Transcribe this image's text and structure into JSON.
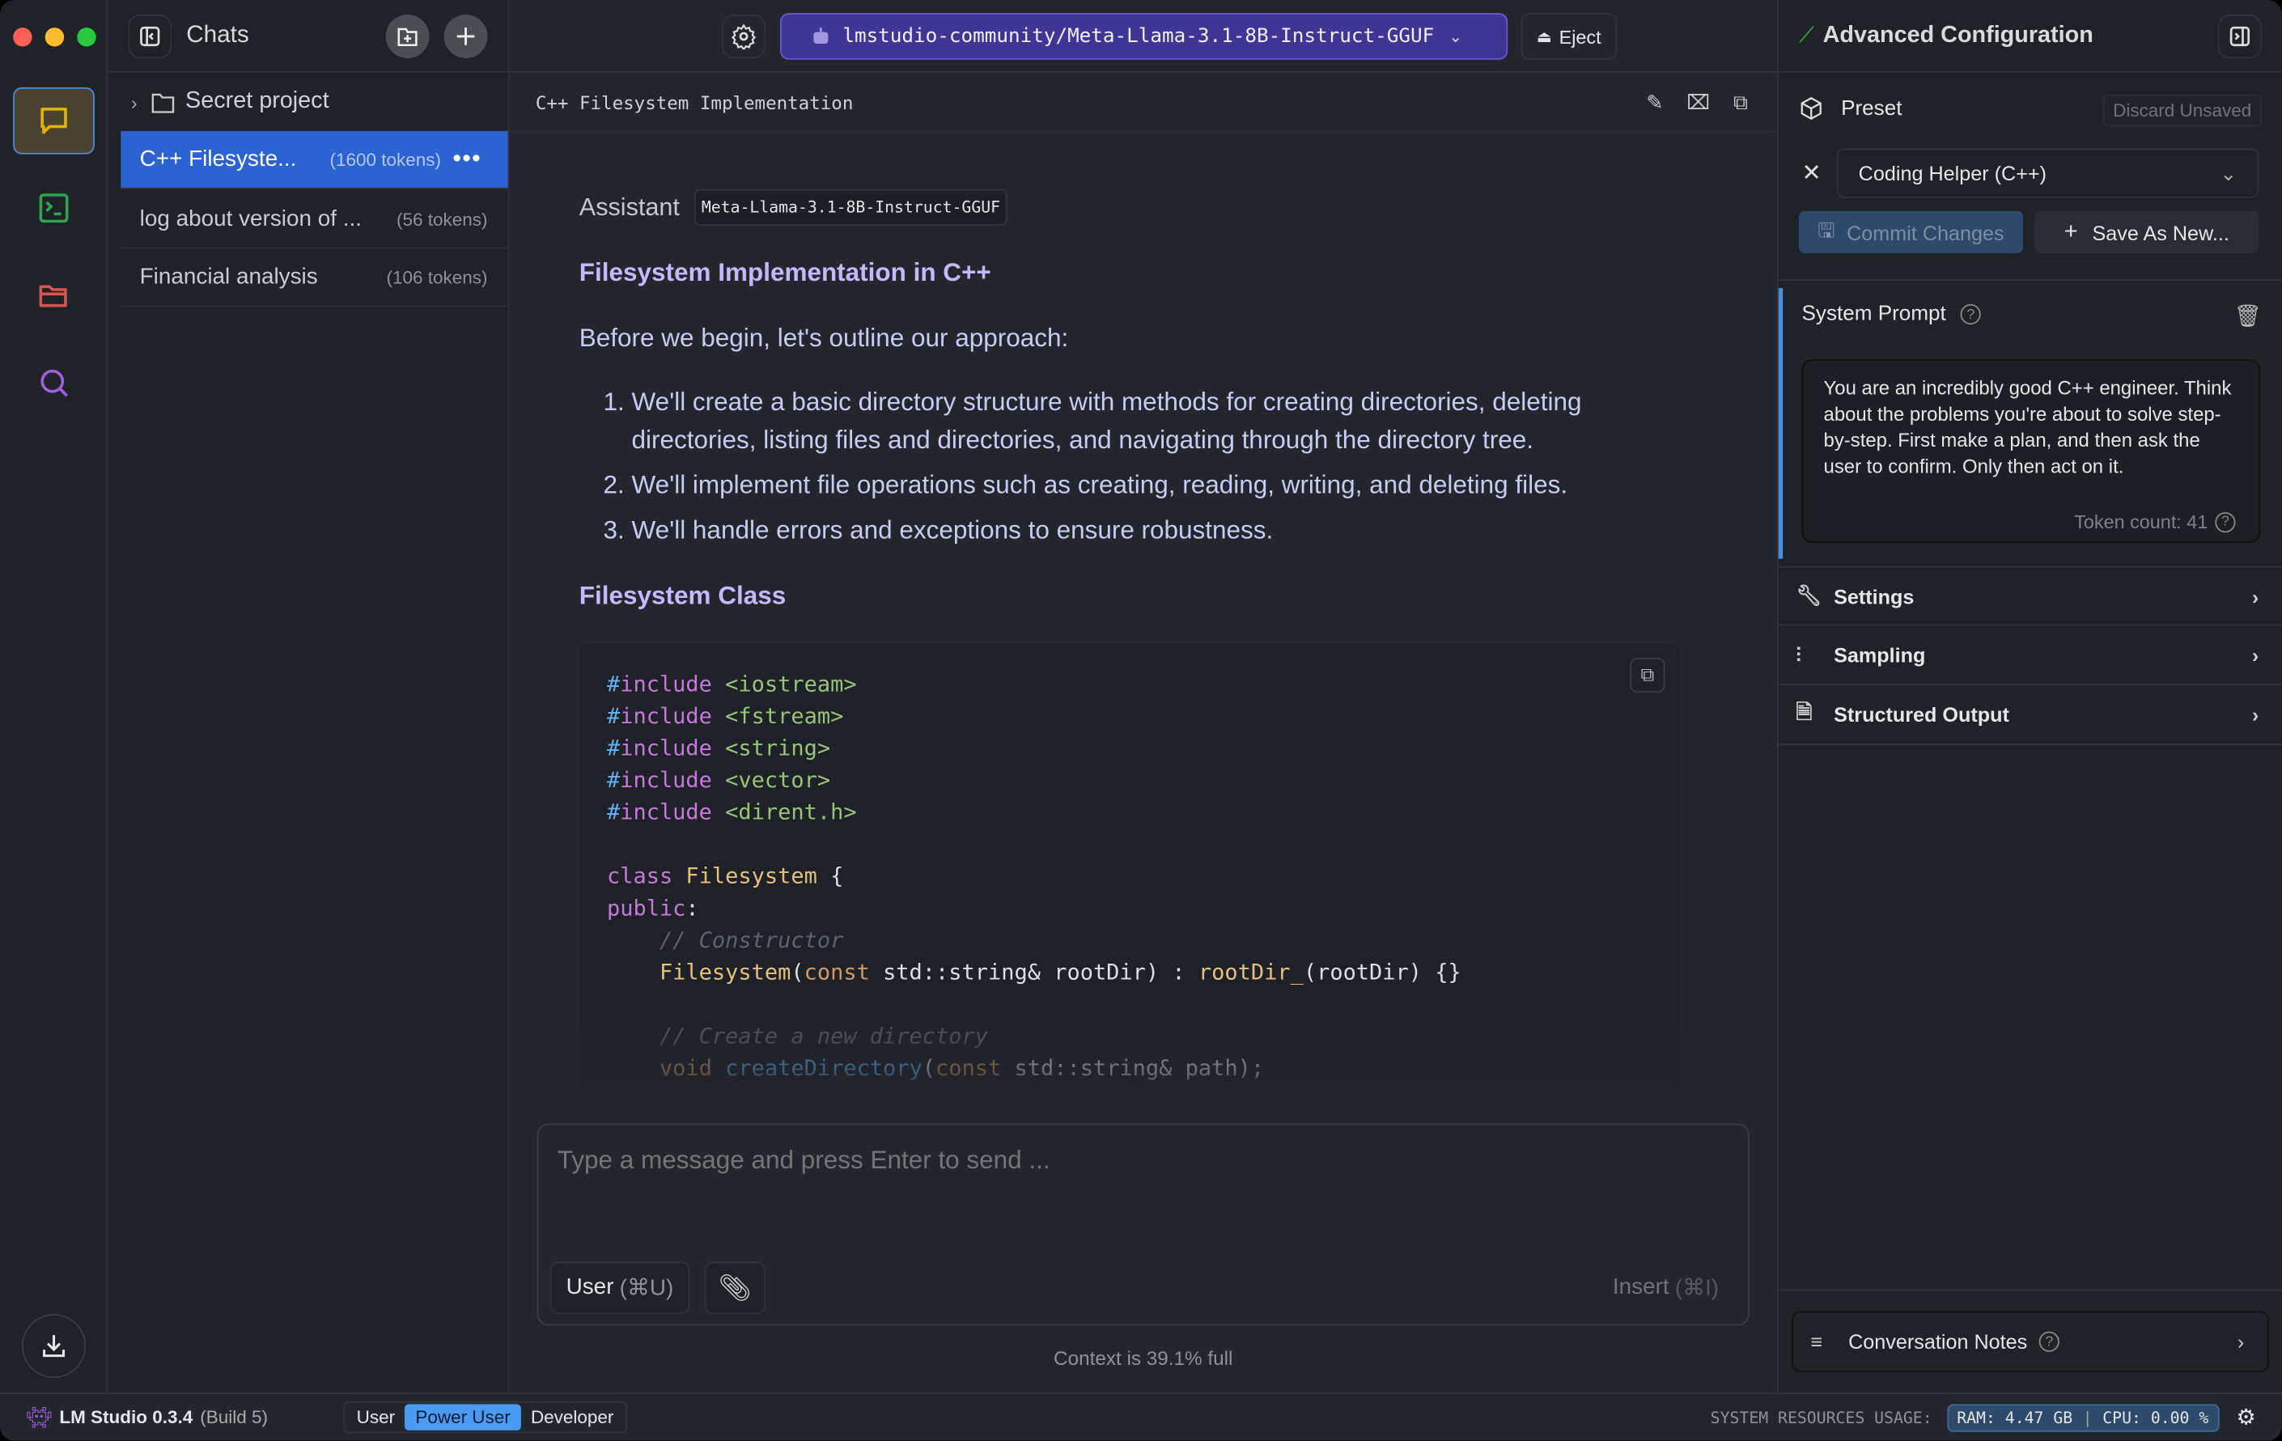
{
  "window": {
    "traffic_lights": {
      "close": "#fe5f57",
      "minimize": "#febc2e",
      "zoom": "#28c840"
    }
  },
  "rail": {
    "items": [
      {
        "name": "chat-icon",
        "color": "#e4b400"
      },
      {
        "name": "terminal-icon",
        "color": "#2ea44f"
      },
      {
        "name": "folder-icon",
        "color": "#d9534f"
      },
      {
        "name": "search-icon",
        "color": "#a25ee0"
      }
    ],
    "download": "download-icon"
  },
  "chats": {
    "title": "Chats",
    "folder": "Secret project",
    "items": [
      {
        "title": "C++ Filesyste...",
        "tokens": "(1600 tokens)",
        "active": true
      },
      {
        "title": "log about version of ...",
        "tokens": "(56 tokens)"
      },
      {
        "title": "Financial analysis",
        "tokens": "(106 tokens)"
      }
    ]
  },
  "toolbar": {
    "model": "lmstudio-community/Meta-Llama-3.1-8B-Instruct-GGUF",
    "eject": "Eject",
    "accent": "#3f3594"
  },
  "conversation": {
    "title": "C++ Filesystem Implementation",
    "role": "Assistant",
    "model_badge": "Meta-Llama-3.1-8B-Instruct-GGUF",
    "heading1": "Filesystem Implementation in C++",
    "intro": "Before we begin, let's outline our approach:",
    "steps": [
      "We'll create a basic directory structure with methods for creating directories, deleting directories, listing files and directories, and navigating through the directory tree.",
      "We'll implement file operations such as creating, reading, writing, and deleting files.",
      "We'll handle errors and exceptions to ensure robustness."
    ],
    "heading2": "Filesystem Class",
    "code": [
      [
        [
          "#",
          "pp"
        ],
        [
          "include",
          "kw"
        ],
        [
          " <iostream>",
          "str"
        ]
      ],
      [
        [
          "#",
          "pp"
        ],
        [
          "include",
          "kw"
        ],
        [
          " <fstream>",
          "str"
        ]
      ],
      [
        [
          "#",
          "pp"
        ],
        [
          "include",
          "kw"
        ],
        [
          " <string>",
          "str"
        ]
      ],
      [
        [
          "#",
          "pp"
        ],
        [
          "include",
          "kw"
        ],
        [
          " <vector>",
          "str"
        ]
      ],
      [
        [
          "#",
          "pp"
        ],
        [
          "include",
          "kw"
        ],
        [
          " <dirent.h>",
          "str"
        ]
      ],
      [],
      [
        [
          "class",
          "kw"
        ],
        [
          " ",
          "pl"
        ],
        [
          "Filesystem",
          "cls"
        ],
        [
          " {",
          "pl"
        ]
      ],
      [
        [
          "public",
          "kw"
        ],
        [
          ":",
          "pl"
        ]
      ],
      [
        [
          "    // Constructor",
          "com"
        ]
      ],
      [
        [
          "    ",
          "pl"
        ],
        [
          "Filesystem",
          "cls"
        ],
        [
          "(",
          "pl"
        ],
        [
          "const",
          "type"
        ],
        [
          " std::string& rootDir) : ",
          "pl"
        ],
        [
          "rootDir_",
          "cls"
        ],
        [
          "(rootDir) {}",
          "pl"
        ]
      ],
      [],
      [
        [
          "    // Create a new directory",
          "com"
        ]
      ],
      [
        [
          "    ",
          "pl"
        ],
        [
          "void",
          "type"
        ],
        [
          " ",
          "pl"
        ],
        [
          "createDirectory",
          "fn"
        ],
        [
          "(",
          "pl"
        ],
        [
          "const",
          "type"
        ],
        [
          " std::string& path);",
          "pl"
        ]
      ]
    ]
  },
  "composer": {
    "placeholder": "Type a message and press Enter to send ...",
    "role_button": "User",
    "role_shortcut": "(⌘U)",
    "insert": "Insert",
    "insert_shortcut": "(⌘I)",
    "context": "Context is 39.1% full"
  },
  "config": {
    "title": "Advanced Configuration",
    "preset_label": "Preset",
    "discard": "Discard Unsaved",
    "preset_value": "Coding Helper (C++)",
    "commit": "Commit Changes",
    "save_new": "Save As New...",
    "system_prompt_label": "System Prompt",
    "system_prompt": "You are an incredibly good C++ engineer. Think about the problems you're about to solve step-by-step. First make a plan, and then ask the user to confirm. Only then act on it.",
    "token_count": "Token count: 41",
    "sections": [
      "Settings",
      "Sampling",
      "Structured Output"
    ],
    "notes": "Conversation Notes"
  },
  "status": {
    "app": "LM Studio 0.3.4",
    "build": "(Build 5)",
    "modes": [
      "User",
      "Power User",
      "Developer"
    ],
    "active_mode": "Power User",
    "resources_label": "SYSTEM RESOURCES USAGE:",
    "ram": "RAM: 4.47 GB",
    "cpu": "CPU: 0.00 %"
  }
}
